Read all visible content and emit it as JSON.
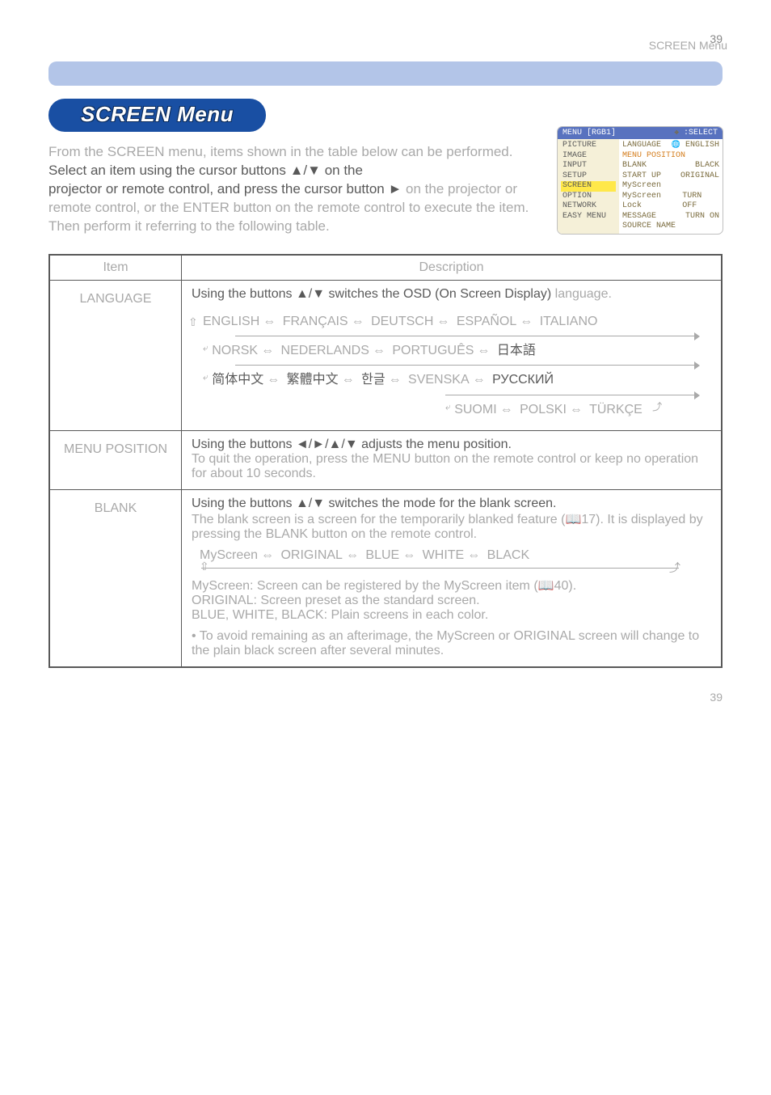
{
  "meta": {
    "page_number_top": "39",
    "page_number_bottom": "39",
    "section_header": "SCREEN Menu"
  },
  "title_pill": "SCREEN Menu",
  "intro": {
    "lead1": "From the SCREEN menu, items shown in the table below can be performed.",
    "main1": "Select an item using the cursor buttons ▲/▼ on the",
    "main2a": "projector or remote control, and press the cursor button ►",
    "main2b": " on the projector or remote control, or the ENTER button on the remote control to execute the item. Then perform it referring to the following table."
  },
  "osd": {
    "top_left": "MENU [RGB1]",
    "top_right_icon": "✥",
    "top_right_label": ":SELECT",
    "left_items": [
      "PICTURE",
      "IMAGE",
      "INPUT",
      "SETUP",
      "SCREEN",
      "OPTION",
      "NETWORK",
      "EASY MENU"
    ],
    "left_selected_index": 4,
    "right_rows": [
      {
        "k": "LANGUAGE",
        "v": "ENGLISH",
        "globe": true
      },
      {
        "k": "MENU POSITION",
        "v": "",
        "sel": true
      },
      {
        "k": "BLANK",
        "v": "BLACK"
      },
      {
        "k": "START UP",
        "v": "ORIGINAL"
      },
      {
        "k": "MyScreen",
        "v": ""
      },
      {
        "k": "MyScreen Lock",
        "v": "TURN OFF"
      },
      {
        "k": "MESSAGE",
        "v": "TURN ON"
      },
      {
        "k": "SOURCE NAME",
        "v": ""
      }
    ]
  },
  "table": {
    "header_item": "Item",
    "header_desc": "Description",
    "rows": [
      {
        "name": "LANGUAGE",
        "d1": "Using the buttons ▲/▼ switches the OSD (On Screen Display)",
        "d1b": " language.",
        "langs": {
          "l1": [
            "ENGLISH",
            "FRANÇAIS",
            "DEUTSCH",
            "ESPAÑOL",
            "ITALIANO"
          ],
          "l2": [
            "NORSK",
            "NEDERLANDS",
            "PORTUGUÊS",
            "日本語"
          ],
          "l3_cjk": [
            "简体中文",
            "繁體中文",
            "한글"
          ],
          "l3_tail": [
            "SVENSKA",
            "РУССКИЙ"
          ],
          "l4": [
            "SUOMI",
            "POLSKI",
            "TÜRKÇE"
          ]
        }
      },
      {
        "name": "MENU POSITION",
        "d1": "Using the buttons ◄/►/▲/▼ adjusts the menu position.",
        "d2": "To quit the operation, press the MENU button on the remote control or keep no operation for about 10 seconds."
      },
      {
        "name": "BLANK",
        "d1": "Using the buttons ▲/▼ switches the mode for the blank screen.",
        "d2a": "The blank screen is a screen for the temporarily blanked feature (",
        "d2b": "17",
        "d2c": "). It is displayed by pressing the BLANK button on the remote control.",
        "opts": [
          "MyScreen",
          "ORIGINAL",
          "BLUE",
          "WHITE",
          "BLACK"
        ],
        "rows2": [
          {
            "k": "MyScreen",
            "v": ": Screen can be registered by the MyScreen item (",
            "ref": "40",
            ")": ")."
          },
          {
            "k": "ORIGINAL",
            "v": ": Screen preset as the standard screen."
          },
          {
            "k": "BLUE, WHITE, BLACK",
            "v": ": Plain screens in each color."
          }
        ],
        "note": "• To avoid remaining as an afterimage, the MyScreen or ORIGINAL screen will change to the plain black screen after several minutes."
      }
    ]
  }
}
